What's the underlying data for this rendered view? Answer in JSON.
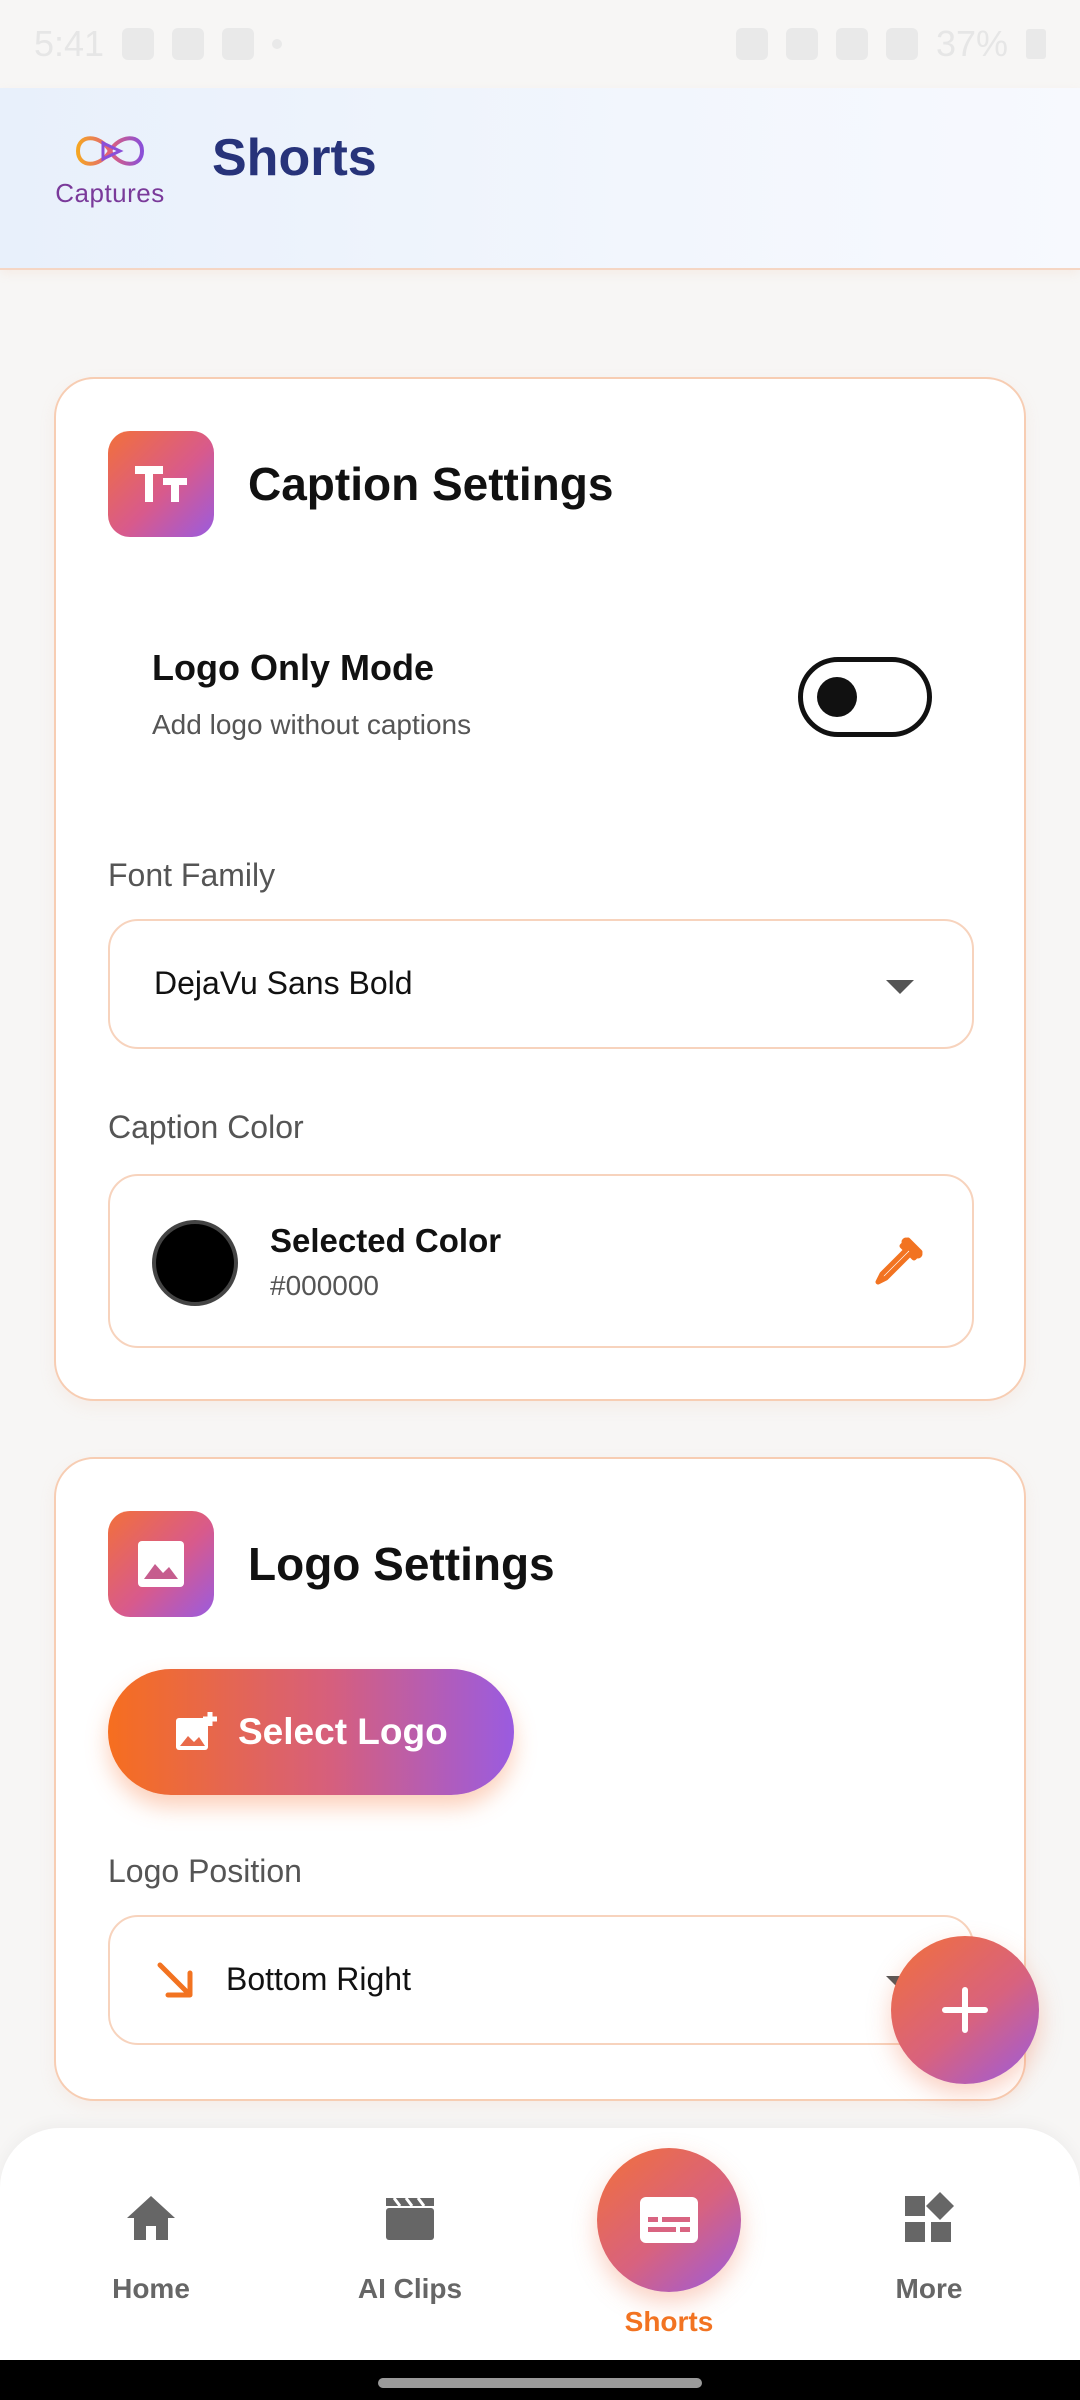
{
  "status_bar": {
    "time": "5:41",
    "battery": "37%"
  },
  "header": {
    "brand_name": "Captures",
    "title": "Shorts"
  },
  "caption_settings": {
    "title": "Caption Settings",
    "icon": "text-size-icon",
    "logo_only_mode": {
      "label": "Logo Only Mode",
      "description": "Add logo without captions",
      "enabled": false
    },
    "font_family": {
      "label": "Font Family",
      "value": "DejaVu Sans Bold"
    },
    "caption_color": {
      "label": "Caption Color",
      "selected_label": "Selected Color",
      "hex": "#000000"
    }
  },
  "logo_settings": {
    "title": "Logo Settings",
    "icon": "image-icon",
    "select_button": "Select Logo",
    "position": {
      "label": "Logo Position",
      "value": "Bottom Right"
    }
  },
  "bottom_nav": {
    "items": [
      {
        "label": "Home",
        "icon": "home-icon"
      },
      {
        "label": "AI Clips",
        "icon": "clapperboard-icon"
      },
      {
        "label": "Shorts",
        "icon": "subtitles-icon",
        "active": true
      },
      {
        "label": "More",
        "icon": "widgets-icon"
      }
    ]
  },
  "colors": {
    "accent_orange": "#f27321",
    "accent_purple": "#9a5bdf",
    "header_title": "#27337a",
    "card_border": "#f7cdb3"
  }
}
